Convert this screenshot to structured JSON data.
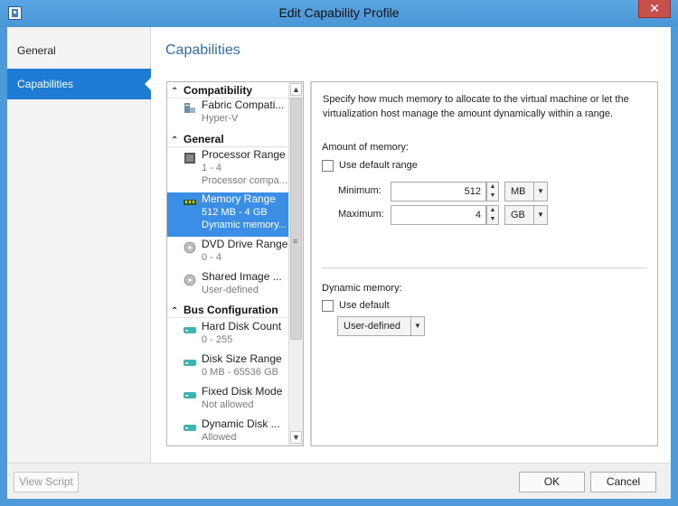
{
  "window": {
    "title": "Edit Capability Profile",
    "close_glyph": "✕"
  },
  "nav": {
    "items": [
      {
        "label": "General"
      },
      {
        "label": "Capabilities"
      }
    ]
  },
  "main": {
    "title": "Capabilities"
  },
  "capability_list": {
    "groups": [
      {
        "label": "Compatibility"
      },
      {
        "label": "General"
      },
      {
        "label": "Bus Configuration"
      }
    ],
    "items": [
      {
        "name": "Fabric Compati...",
        "value": "Hyper-V",
        "icon": "fabric-icon"
      },
      {
        "name": "Processor Range",
        "value": "1 - 4",
        "extra": "Processor compa...",
        "icon": "processor-icon"
      },
      {
        "name": "Memory Range",
        "value": "512 MB - 4  GB",
        "extra": "Dynamic memory...",
        "icon": "memory-icon"
      },
      {
        "name": "DVD Drive Range",
        "value": "0 - 4",
        "icon": "dvd-icon"
      },
      {
        "name": "Shared Image ...",
        "value": "User-defined",
        "icon": "shared-image-icon"
      },
      {
        "name": "Hard Disk Count",
        "value": "0 - 255",
        "icon": "hard-disk-icon"
      },
      {
        "name": "Disk Size Range",
        "value": "0 MB - 65536  GB",
        "icon": "disk-size-icon"
      },
      {
        "name": "Fixed Disk Mode",
        "value": "Not allowed",
        "icon": "fixed-disk-icon"
      },
      {
        "name": "Dynamic Disk ...",
        "value": "Allowed",
        "icon": "dynamic-disk-icon"
      }
    ],
    "selected_item": "Memory Range"
  },
  "detail": {
    "description": "Specify how much memory to allocate to the virtual machine or let the virtualization host manage the amount dynamically within a range.",
    "amount_label": "Amount of memory:",
    "use_default_range_label": "Use default range",
    "use_default_range_checked": false,
    "minimum_label": "Minimum:",
    "minimum_value": "512",
    "minimum_unit": "MB",
    "maximum_label": "Maximum:",
    "maximum_value": "4",
    "maximum_unit": "GB",
    "dynamic_label": "Dynamic memory:",
    "use_default_label": "Use default",
    "use_default_checked": false,
    "dynamic_mode": "User-defined"
  },
  "footer": {
    "view_script": "View Script",
    "ok": "OK",
    "cancel": "Cancel"
  },
  "colors": {
    "titlebar": "#4e9ad8",
    "selection": "#3a8ee6",
    "accent_title": "#2f6da8"
  }
}
